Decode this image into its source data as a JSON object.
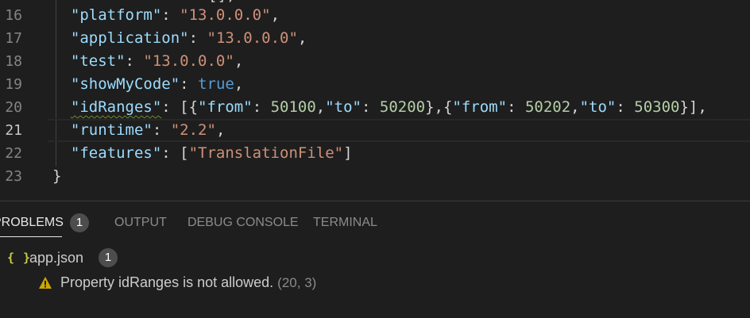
{
  "editor": {
    "top_stub": "[],",
    "lines": [
      {
        "num": "16",
        "tokens": [
          [
            "k",
            "\"platform\""
          ],
          [
            "p",
            ": "
          ],
          [
            "s",
            "\"13.0.0.0\""
          ],
          [
            "p",
            ","
          ]
        ]
      },
      {
        "num": "17",
        "tokens": [
          [
            "k",
            "\"application\""
          ],
          [
            "p",
            ": "
          ],
          [
            "s",
            "\"13.0.0.0\""
          ],
          [
            "p",
            ","
          ]
        ]
      },
      {
        "num": "18",
        "tokens": [
          [
            "k",
            "\"test\""
          ],
          [
            "p",
            ": "
          ],
          [
            "s",
            "\"13.0.0.0\""
          ],
          [
            "p",
            ","
          ]
        ]
      },
      {
        "num": "19",
        "tokens": [
          [
            "k",
            "\"showMyCode\""
          ],
          [
            "p",
            ": "
          ],
          [
            "b",
            "true"
          ],
          [
            "p",
            ","
          ]
        ]
      },
      {
        "num": "20",
        "tokens": [
          [
            "kw",
            "\"idRanges\""
          ],
          [
            "p",
            ": [{"
          ],
          [
            "k",
            "\"from\""
          ],
          [
            "p",
            ": "
          ],
          [
            "n",
            "50100"
          ],
          [
            "p",
            ","
          ],
          [
            "k",
            "\"to\""
          ],
          [
            "p",
            ": "
          ],
          [
            "n",
            "50200"
          ],
          [
            "p",
            "},{"
          ],
          [
            "k",
            "\"from\""
          ],
          [
            "p",
            ": "
          ],
          [
            "n",
            "50202"
          ],
          [
            "p",
            ","
          ],
          [
            "k",
            "\"to\""
          ],
          [
            "p",
            ": "
          ],
          [
            "n",
            "50300"
          ],
          [
            "p",
            "}],"
          ]
        ]
      },
      {
        "num": "21",
        "tokens": [
          [
            "k",
            "\"runtime\""
          ],
          [
            "p",
            ": "
          ],
          [
            "s",
            "\"2.2\""
          ],
          [
            "p",
            ","
          ]
        ],
        "current": true
      },
      {
        "num": "22",
        "tokens": [
          [
            "k",
            "\"features\""
          ],
          [
            "p",
            ": ["
          ],
          [
            "s",
            "\"TranslationFile\""
          ],
          [
            "p",
            "]"
          ]
        ]
      },
      {
        "num": "23",
        "tokens": [
          [
            "p",
            "}"
          ]
        ],
        "indent": 0
      }
    ]
  },
  "panel": {
    "tabs": [
      {
        "label": "PROBLEMS",
        "active": true,
        "badge": "1"
      },
      {
        "label": "OUTPUT"
      },
      {
        "label": "DEBUG CONSOLE"
      },
      {
        "label": "TERMINAL"
      }
    ],
    "file": {
      "icon": "json-braces-icon",
      "icon_glyph": "{ }",
      "name": "app.json",
      "count": "1"
    },
    "problem": {
      "icon": "warning-icon",
      "message": "Property idRanges is not allowed.",
      "location": "(20, 3)"
    }
  },
  "colors": {
    "background": "#1e1e1e",
    "key": "#9cdcfe",
    "string": "#ce9178",
    "number": "#b5cea8",
    "boolean": "#569cd6",
    "warning": "#cca700"
  }
}
